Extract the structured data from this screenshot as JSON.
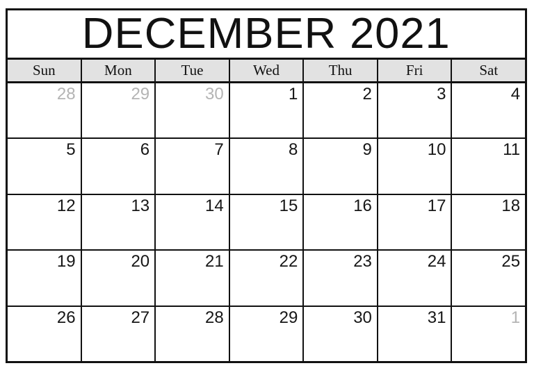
{
  "header": {
    "month": "DECEMBER",
    "year": "2021",
    "title": "DECEMBER 2021"
  },
  "weekdays": [
    {
      "label": "Sun"
    },
    {
      "label": "Mon"
    },
    {
      "label": "Tue"
    },
    {
      "label": "Wed"
    },
    {
      "label": "Thu"
    },
    {
      "label": "Fri"
    },
    {
      "label": "Sat"
    }
  ],
  "colors": {
    "border": "#111111",
    "header_background": "#e2e2e2",
    "cell_background": "#ffffff",
    "day_number": "#161616",
    "adjacent_day_number": "#b4b4b4"
  },
  "weeks": [
    {
      "days": [
        {
          "number": "28",
          "adjacent": true
        },
        {
          "number": "29",
          "adjacent": true
        },
        {
          "number": "30",
          "adjacent": true
        },
        {
          "number": "1",
          "adjacent": false
        },
        {
          "number": "2",
          "adjacent": false
        },
        {
          "number": "3",
          "adjacent": false
        },
        {
          "number": "4",
          "adjacent": false
        }
      ]
    },
    {
      "days": [
        {
          "number": "5",
          "adjacent": false
        },
        {
          "number": "6",
          "adjacent": false
        },
        {
          "number": "7",
          "adjacent": false
        },
        {
          "number": "8",
          "adjacent": false
        },
        {
          "number": "9",
          "adjacent": false
        },
        {
          "number": "10",
          "adjacent": false
        },
        {
          "number": "11",
          "adjacent": false
        }
      ]
    },
    {
      "days": [
        {
          "number": "12",
          "adjacent": false
        },
        {
          "number": "13",
          "adjacent": false
        },
        {
          "number": "14",
          "adjacent": false
        },
        {
          "number": "15",
          "adjacent": false
        },
        {
          "number": "16",
          "adjacent": false
        },
        {
          "number": "17",
          "adjacent": false
        },
        {
          "number": "18",
          "adjacent": false
        }
      ]
    },
    {
      "days": [
        {
          "number": "19",
          "adjacent": false
        },
        {
          "number": "20",
          "adjacent": false
        },
        {
          "number": "21",
          "adjacent": false
        },
        {
          "number": "22",
          "adjacent": false
        },
        {
          "number": "23",
          "adjacent": false
        },
        {
          "number": "24",
          "adjacent": false
        },
        {
          "number": "25",
          "adjacent": false
        }
      ]
    },
    {
      "days": [
        {
          "number": "26",
          "adjacent": false
        },
        {
          "number": "27",
          "adjacent": false
        },
        {
          "number": "28",
          "adjacent": false
        },
        {
          "number": "29",
          "adjacent": false
        },
        {
          "number": "30",
          "adjacent": false
        },
        {
          "number": "31",
          "adjacent": false
        },
        {
          "number": "1",
          "adjacent": true
        }
      ]
    }
  ]
}
